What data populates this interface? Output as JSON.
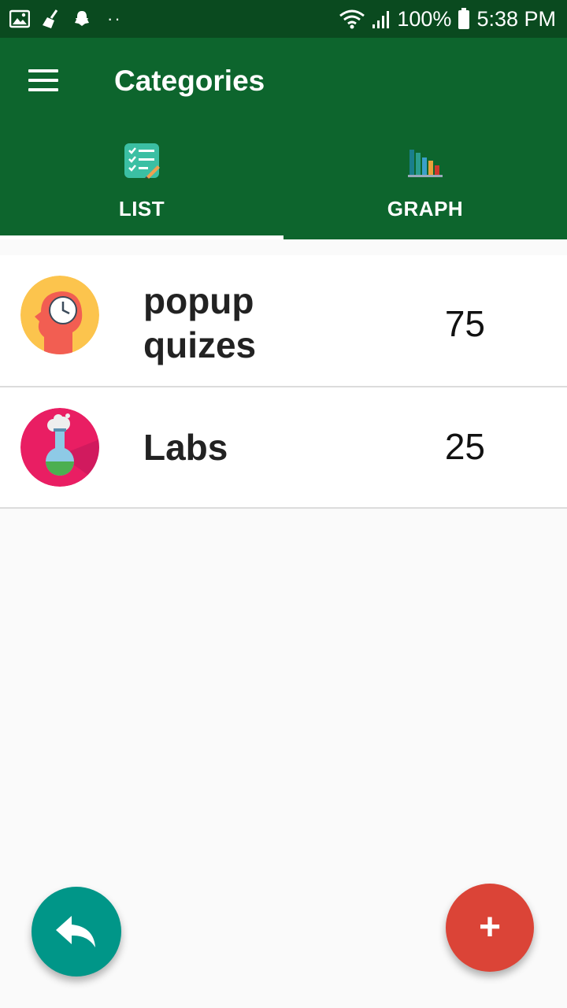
{
  "status_bar": {
    "battery": "100%",
    "time": "5:38 PM",
    "left_icons": [
      "gallery-icon",
      "broom-icon",
      "snapchat-icon",
      "more-dots-icon"
    ],
    "right_icons": [
      "wifi-icon",
      "signal-icon",
      "battery-icon"
    ]
  },
  "app_bar": {
    "title": "Categories",
    "menu_icon": "hamburger-menu-icon",
    "color": "#0d652d"
  },
  "tabs": [
    {
      "label": "LIST",
      "icon": "checklist-icon",
      "selected": true
    },
    {
      "label": "GRAPH",
      "icon": "bar-chart-icon",
      "selected": false
    }
  ],
  "categories": [
    {
      "name": "popup quizes",
      "count": "75",
      "icon": "head-clock-icon"
    },
    {
      "name": "Labs",
      "count": "25",
      "icon": "flask-icon"
    }
  ],
  "fabs": {
    "back_icon": "reply-arrow-icon",
    "add_label": "+",
    "back_color": "#009688",
    "add_color": "#db4437"
  }
}
